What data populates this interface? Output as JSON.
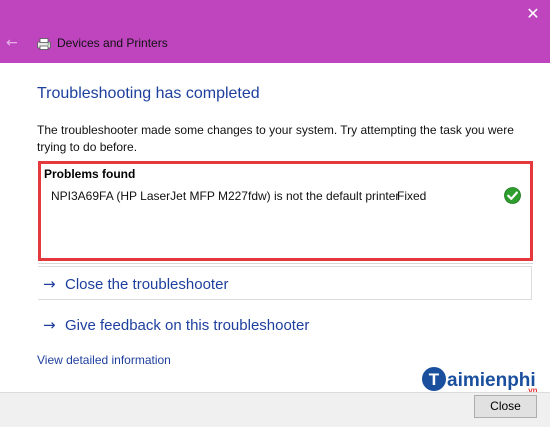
{
  "window": {
    "title": "Devices and Printers",
    "close_glyph": "✕",
    "back_glyph": "←",
    "titlebar_color": "#bf45bf"
  },
  "content": {
    "heading": "Troubleshooting has completed",
    "description": "The troubleshooter made some changes to your system. Try attempting the task you were trying to do before."
  },
  "problems": {
    "title": "Problems found",
    "highlight_color": "#e3393d",
    "items": [
      {
        "text": "NPI3A69FA (HP LaserJet MFP M227fdw) is not the default printer",
        "status": "Fixed",
        "icon": "green-check-icon"
      }
    ]
  },
  "links": {
    "close_troubleshooter": "Close the troubleshooter",
    "give_feedback": "Give feedback on this troubleshooter",
    "view_details": "View detailed information",
    "arrow_glyph": "→"
  },
  "footer": {
    "close_button": "Close"
  },
  "watermark": {
    "text": "aimienphi",
    "suffix": ".vn",
    "initial": "T"
  }
}
